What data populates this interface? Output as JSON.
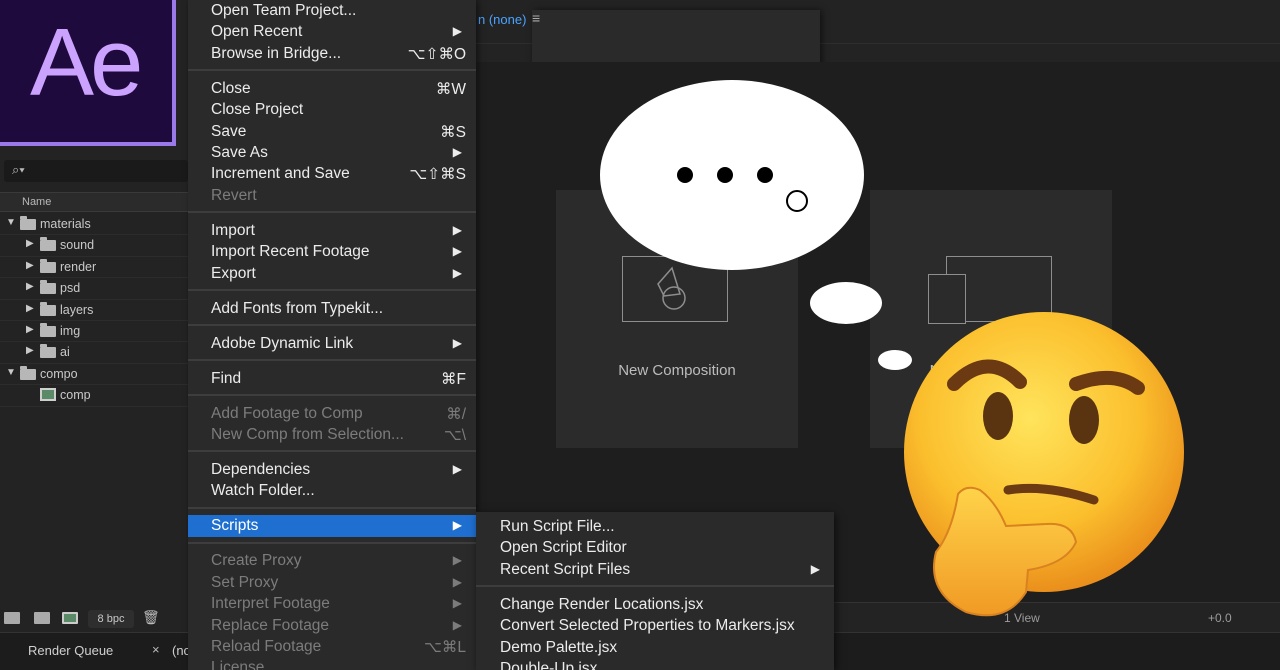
{
  "app_logo_text": "Ae",
  "project_panel": {
    "column_header": "Name",
    "tree": [
      {
        "label": "materials",
        "level": 0,
        "type": "folder",
        "expanded": true
      },
      {
        "label": "sound",
        "level": 1,
        "type": "folder",
        "expanded": false
      },
      {
        "label": "render",
        "level": 1,
        "type": "folder",
        "expanded": false
      },
      {
        "label": "psd",
        "level": 1,
        "type": "folder",
        "expanded": false
      },
      {
        "label": "layers",
        "level": 1,
        "type": "folder",
        "expanded": false
      },
      {
        "label": "img",
        "level": 1,
        "type": "folder",
        "expanded": false
      },
      {
        "label": "ai",
        "level": 1,
        "type": "folder",
        "expanded": false
      },
      {
        "label": "compo",
        "level": 0,
        "type": "folder",
        "expanded": true
      },
      {
        "label": "comp",
        "level": 1,
        "type": "composition"
      }
    ],
    "bpc_label": "8 bpc"
  },
  "bottom_bar": {
    "render_queue_label": "Render Queue",
    "close_glyph": "×",
    "second_tab_label": "(no"
  },
  "composition": {
    "header_name": "n (none)",
    "menu_glyph": "≡",
    "new_composition_label": "New Composition",
    "second_tile_label": "N",
    "view_label": "1 View",
    "offset_label": "+0.0"
  },
  "file_menu": {
    "items": [
      {
        "label": "Open Team Project...",
        "shortcut": "",
        "arrow": false,
        "disabled": false
      },
      {
        "label": "Open Recent",
        "shortcut": "",
        "arrow": true,
        "disabled": false
      },
      {
        "label": "Browse in Bridge...",
        "shortcut": "⌥⇧⌘O",
        "arrow": false,
        "disabled": false
      },
      {
        "label": "Close",
        "shortcut": "⌘W",
        "arrow": false,
        "disabled": false
      },
      {
        "label": "Close Project",
        "shortcut": "",
        "arrow": false,
        "disabled": false
      },
      {
        "label": "Save",
        "shortcut": "⌘S",
        "arrow": false,
        "disabled": false
      },
      {
        "label": "Save As",
        "shortcut": "",
        "arrow": true,
        "disabled": false
      },
      {
        "label": "Increment and Save",
        "shortcut": "⌥⇧⌘S",
        "arrow": false,
        "disabled": false
      },
      {
        "label": "Revert",
        "shortcut": "",
        "arrow": false,
        "disabled": true
      },
      {
        "label": "Import",
        "shortcut": "",
        "arrow": true,
        "disabled": false
      },
      {
        "label": "Import Recent Footage",
        "shortcut": "",
        "arrow": true,
        "disabled": false
      },
      {
        "label": "Export",
        "shortcut": "",
        "arrow": true,
        "disabled": false
      },
      {
        "label": "Add Fonts from Typekit...",
        "shortcut": "",
        "arrow": false,
        "disabled": false
      },
      {
        "label": "Adobe Dynamic Link",
        "shortcut": "",
        "arrow": true,
        "disabled": false
      },
      {
        "label": "Find",
        "shortcut": "⌘F",
        "arrow": false,
        "disabled": false
      },
      {
        "label": "Add Footage to Comp",
        "shortcut": "⌘/",
        "arrow": false,
        "disabled": true
      },
      {
        "label": "New Comp from Selection...",
        "shortcut": "⌥\\",
        "arrow": false,
        "disabled": true
      },
      {
        "label": "Dependencies",
        "shortcut": "",
        "arrow": true,
        "disabled": false
      },
      {
        "label": "Watch Folder...",
        "shortcut": "",
        "arrow": false,
        "disabled": false
      },
      {
        "label": "Scripts",
        "shortcut": "",
        "arrow": true,
        "disabled": false,
        "selected": true
      },
      {
        "label": "Create Proxy",
        "shortcut": "",
        "arrow": true,
        "disabled": true
      },
      {
        "label": "Set Proxy",
        "shortcut": "",
        "arrow": true,
        "disabled": true
      },
      {
        "label": "Interpret Footage",
        "shortcut": "",
        "arrow": true,
        "disabled": true
      },
      {
        "label": "Replace Footage",
        "shortcut": "",
        "arrow": true,
        "disabled": true
      },
      {
        "label": "Reload Footage",
        "shortcut": "⌥⌘L",
        "arrow": false,
        "disabled": true
      },
      {
        "label": "License...",
        "shortcut": "",
        "arrow": false,
        "disabled": true
      }
    ]
  },
  "scripts_submenu": {
    "items": [
      {
        "label": "Run Script File...",
        "arrow": false
      },
      {
        "label": "Open Script Editor",
        "arrow": false
      },
      {
        "label": "Recent Script Files",
        "arrow": true
      },
      {
        "label": "Change Render Locations.jsx",
        "arrow": false
      },
      {
        "label": "Convert Selected Properties to Markers.jsx",
        "arrow": false
      },
      {
        "label": "Demo Palette.jsx",
        "arrow": false
      },
      {
        "label": "Double-Up.jsx",
        "arrow": false
      }
    ]
  },
  "colors": {
    "accent_selected": "#1f6fd1",
    "logo_bg": "#1f0a3d",
    "logo_text": "#cba3ff",
    "link_blue": "#4aa3ff"
  }
}
